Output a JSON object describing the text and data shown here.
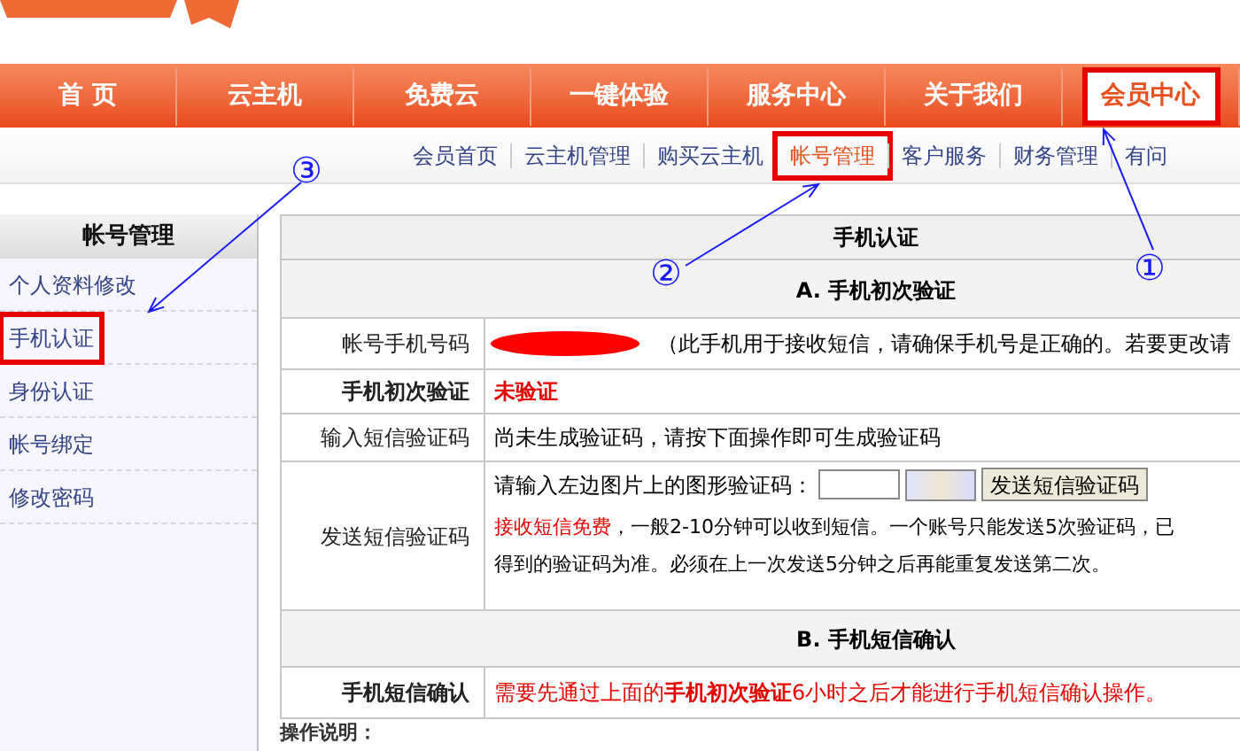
{
  "nav": [
    {
      "label": "首 页",
      "selected": false,
      "boxed": false
    },
    {
      "label": "云主机",
      "selected": false,
      "boxed": false
    },
    {
      "label": "免费云",
      "selected": false,
      "boxed": false
    },
    {
      "label": "一键体验",
      "selected": false,
      "boxed": false
    },
    {
      "label": "服务中心",
      "selected": false,
      "boxed": false
    },
    {
      "label": "关于我们",
      "selected": false,
      "boxed": false
    },
    {
      "label": "会员中心",
      "selected": true,
      "boxed": true
    }
  ],
  "subnav": [
    {
      "label": "会员首页",
      "selected": false,
      "boxed": false
    },
    {
      "label": "云主机管理",
      "selected": false,
      "boxed": false
    },
    {
      "label": "购买云主机",
      "selected": false,
      "boxed": false
    },
    {
      "label": "帐号管理",
      "selected": true,
      "boxed": true
    },
    {
      "label": "客户服务",
      "selected": false,
      "boxed": false
    },
    {
      "label": "财务管理",
      "selected": false,
      "boxed": false
    },
    {
      "label": "有问",
      "selected": false,
      "boxed": false
    }
  ],
  "sidebar": {
    "title": "帐号管理",
    "items": [
      {
        "label": "个人资料修改",
        "boxed": false
      },
      {
        "label": "手机认证",
        "boxed": true
      },
      {
        "label": "身份认证",
        "boxed": false
      },
      {
        "label": "帐号绑定",
        "boxed": false
      },
      {
        "label": "修改密码",
        "boxed": false
      }
    ]
  },
  "panel": {
    "title": "手机认证",
    "section_a": "A. 手机初次验证",
    "phone_row": {
      "label": "帐号手机号码",
      "note": "（此手机用于接收短信，请确保手机号是正确的。若要更改请"
    },
    "status_row": {
      "label": "手机初次验证",
      "value": "未验证"
    },
    "code_row": {
      "label": "输入短信验证码",
      "value": "尚未生成验证码，请按下面操作即可生成验证码"
    },
    "send_row": {
      "label": "发送短信验证码",
      "prompt": "请输入左边图片上的图形验证码：",
      "button": "发送短信验证码",
      "highlight": "接收短信免费",
      "text": "，一般2-10分钟可以收到短信。一个账号只能发送5次验证码，已",
      "text_2": "得到的验证码为准。必须在上一次发送5分钟之后再能重复发送第二次。"
    },
    "section_b": "B. 手机短信确认",
    "confirm_row": {
      "label": "手机短信确认",
      "value": "需要先通过上面的**手机初次验证**6小时之后才能进行手机短信确认操作。"
    }
  },
  "footer_heading": "操作说明：",
  "annotations": [
    {
      "label": "①"
    },
    {
      "label": "②"
    },
    {
      "label": "③"
    }
  ]
}
